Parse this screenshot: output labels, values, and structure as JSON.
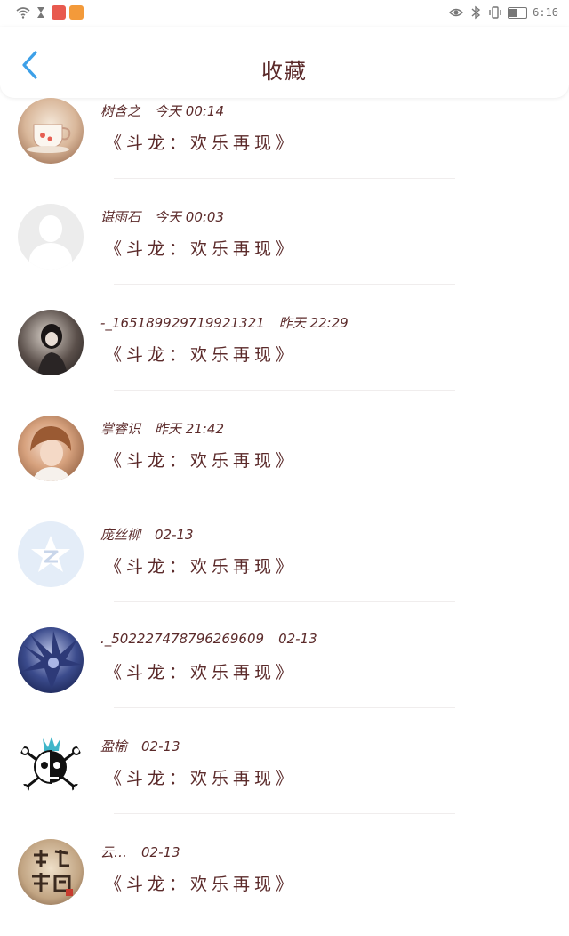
{
  "status_bar": {
    "time": "6:16"
  },
  "header": {
    "title": "收藏"
  },
  "favorites": [
    {
      "avatar": "teacup-photo",
      "user": "树含之",
      "time": "今天 00:14",
      "book": "《斗龙：欢乐再现》"
    },
    {
      "avatar": "default-avatar",
      "user": "谌雨石",
      "time": "今天 00:03",
      "book": "《斗龙：欢乐再现》"
    },
    {
      "avatar": "girl-photo",
      "user": "-_165189929719921321",
      "time": "昨天 22:29",
      "book": "《斗龙：欢乐再现》"
    },
    {
      "avatar": "portrait-photo",
      "user": "掌睿识",
      "time": "昨天 21:42",
      "book": "《斗龙：欢乐再现》"
    },
    {
      "avatar": "qzone-star-logo",
      "user": "庞丝柳",
      "time": "02-13",
      "book": "《斗龙：欢乐再现》"
    },
    {
      "avatar": "anime-photo",
      "user": "._502227478796269609",
      "time": "02-13",
      "book": "《斗龙：欢乐再现》"
    },
    {
      "avatar": "skull-cartoon",
      "user": "盈榆",
      "time": "02-13",
      "book": "《斗龙：欢乐再现》"
    },
    {
      "avatar": "peace-calligraphy",
      "user": "云…",
      "time": "02-13",
      "book": "《斗龙：欢乐再现》"
    }
  ],
  "colors": {
    "text": "#5b2a2a",
    "back_arrow": "#3da0e8"
  }
}
